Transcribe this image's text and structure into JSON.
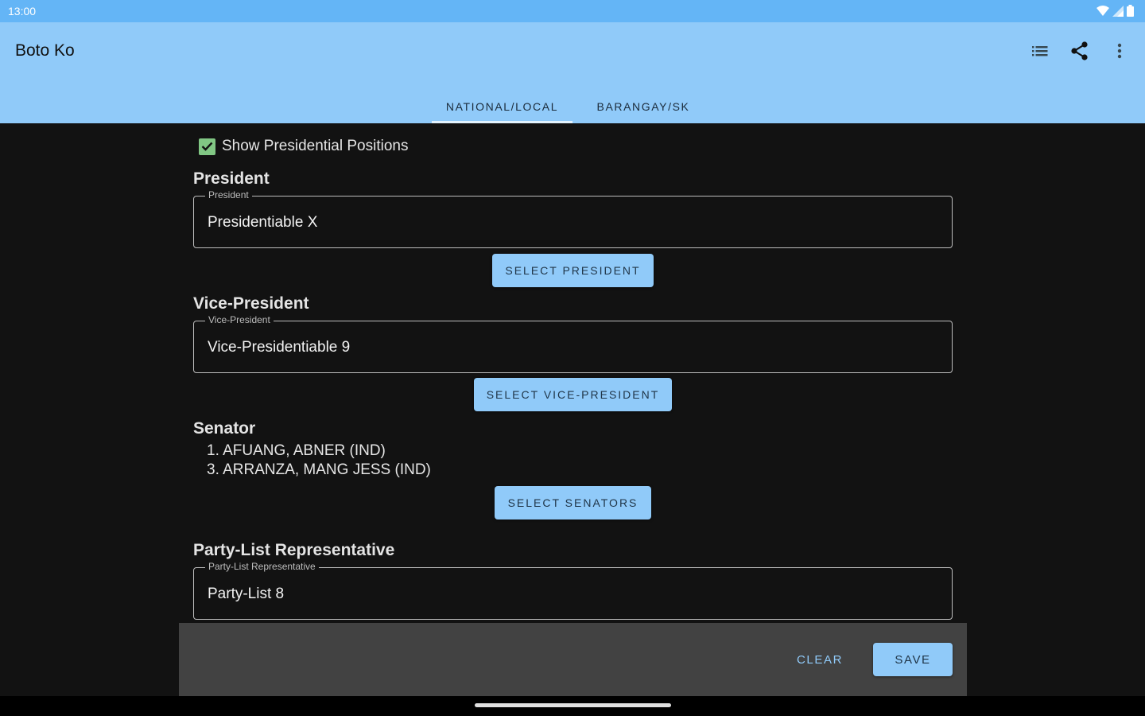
{
  "status_bar": {
    "time": "13:00"
  },
  "app_bar": {
    "title": "Boto Ko",
    "actions": [
      "list-icon",
      "share-icon",
      "more-vert-icon"
    ]
  },
  "tabs": [
    {
      "label": "NATIONAL/LOCAL",
      "selected": true
    },
    {
      "label": "BARANGAY/SK",
      "selected": false
    }
  ],
  "show_presidential": {
    "label": "Show Presidential Positions",
    "checked": true
  },
  "president": {
    "title": "President",
    "field_label": "President",
    "value": "Presidentiable X",
    "button": "SELECT PRESIDENT"
  },
  "vice_president": {
    "title": "Vice-President",
    "field_label": "Vice-President",
    "value": "Vice-Presidentiable 9",
    "button": "SELECT VICE-PRESIDENT"
  },
  "senator": {
    "title": "Senator",
    "items": [
      "1. AFUANG, ABNER (IND)",
      "3. ARRANZA, MANG JESS (IND)"
    ],
    "button": "SELECT SENATORS"
  },
  "party_list": {
    "title": "Party-List Representative",
    "field_label": "Party-List Representative",
    "value": "Party-List 8"
  },
  "bottom_bar": {
    "clear_label": "CLEAR",
    "save_label": "SAVE"
  },
  "colors": {
    "status_bar": "#64b5f6",
    "app_bar": "#90caf9",
    "background": "#121212",
    "accent": "#90caf9",
    "bottom_bar": "#424242"
  }
}
